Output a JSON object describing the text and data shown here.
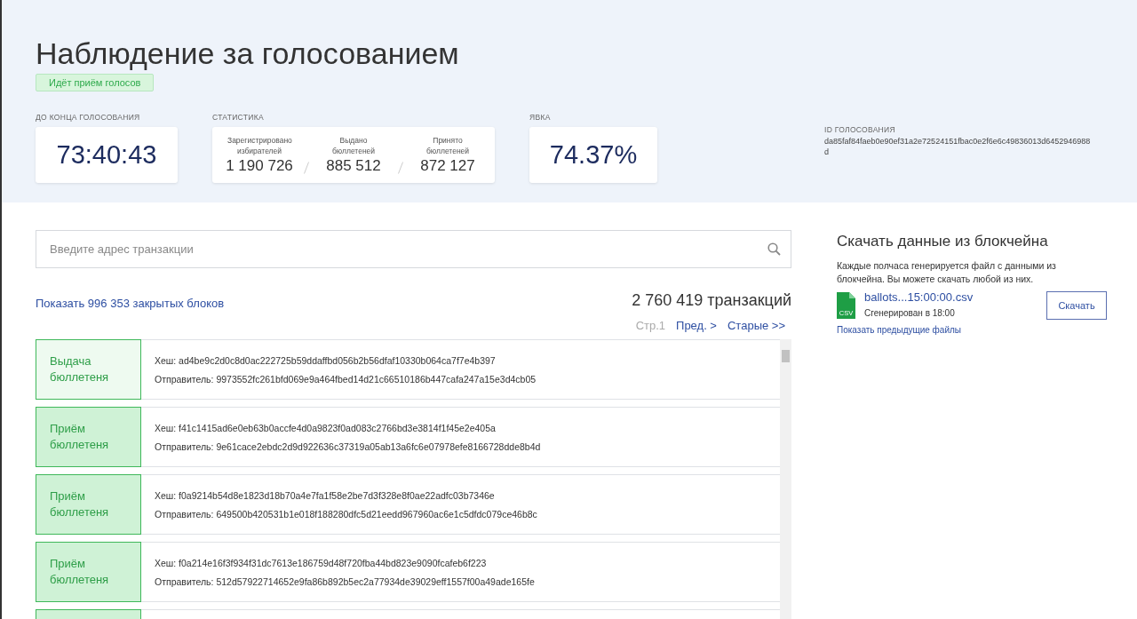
{
  "title": "Наблюдение за голосованием",
  "status_badge": "Идёт приём голосов",
  "countdown": {
    "label": "ДО КОНЦА ГОЛОСОВАНИЯ",
    "value": "73:40:43"
  },
  "statistics": {
    "label": "СТАТИСТИКА",
    "items": [
      {
        "caption": "Зарегистрировано избирателей",
        "value": "1 190 726"
      },
      {
        "caption": "Выдано бюллетеней",
        "value": "885 512"
      },
      {
        "caption": "Принято бюллетеней",
        "value": "872 127"
      }
    ]
  },
  "turnout": {
    "label": "ЯВКА",
    "value": "74.37%"
  },
  "voting_id": {
    "label": "ID ГОЛОСОВАНИЯ",
    "value": "da85faf84faeb0e90ef31a2e72524151fbac0e2f6e6c49836013d6452946988d"
  },
  "search": {
    "placeholder": "Введите адрес транзакции"
  },
  "closed_blocks_link": "Показать 996 353 закрытых блоков",
  "transaction_count": "2 760 419 транзакций",
  "pagination": {
    "current": "Стр.1",
    "prev": "Пред. >",
    "older": "Старые >>"
  },
  "transactions": [
    {
      "kind": "issue",
      "label": "Выдача бюллетеня",
      "hash": "Хеш: ad4be9c2d0c8d0ac222725b59ddaffbd056b2b56dfaf10330b064ca7f7e4b397",
      "sender": "Отправитель: 9973552fc261bfd069e9a464fbed14d21c66510186b447cafa247a15e3d4cb05"
    },
    {
      "kind": "accept",
      "label": "Приём бюллетеня",
      "hash": "Хеш: f41c1415ad6e0eb63b0accfe4d0a9823f0ad083c2766bd3e3814f1f45e2e405a",
      "sender": "Отправитель: 9e61cace2ebdc2d9d922636c37319a05ab13a6fc6e07978efe8166728dde8b4d"
    },
    {
      "kind": "accept",
      "label": "Приём бюллетеня",
      "hash": "Хеш: f0a9214b54d8e1823d18b70a4e7fa1f58e2be7d3f328e8f0ae22adfc03b7346e",
      "sender": "Отправитель: 649500b420531b1e018f188280dfc5d21eedd967960ac6e1c5dfdc079ce46b8c"
    },
    {
      "kind": "accept",
      "label": "Приём бюллетеня",
      "hash": "Хеш: f0a214e16f3f934f31dc7613e186759d48f720fba44bd823e9090fcafeb6f223",
      "sender": "Отправитель: 512d57922714652e9fa86b892b5ec2a77934de39029eff1557f00a49ade165fe"
    },
    {
      "kind": "accept"
    }
  ],
  "download": {
    "title": "Скачать данные из блокчейна",
    "description": "Каждые полчаса генерируется файл с данными из блокчейна. Вы можете скачать любой из них.",
    "file_type": "CSV",
    "file_name": "ballots...15:00:00.csv",
    "generated": "Сгенерирован в 18:00",
    "button": "Скачать",
    "previous_link": "Показать предыдущие файлы"
  }
}
